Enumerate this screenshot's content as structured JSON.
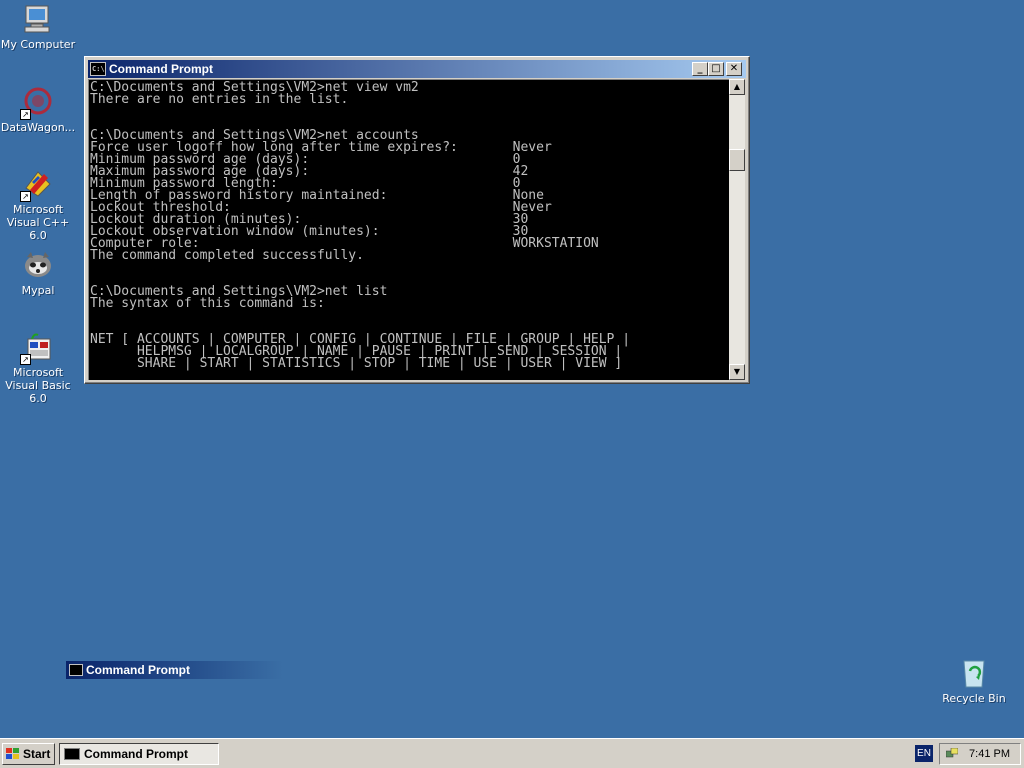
{
  "desktop": {
    "icons": [
      {
        "label": "My Computer",
        "icon": "my-computer-icon"
      },
      {
        "label": "DataWagon...",
        "icon": "datawagon-icon"
      },
      {
        "label": "Microsoft Visual C++ 6.0",
        "icon": "visual-cpp-icon"
      },
      {
        "label": "Mypal",
        "icon": "mypal-browser-icon"
      },
      {
        "label": "Microsoft Visual Basic 6.0",
        "icon": "visual-basic-icon"
      },
      {
        "label": "Recycle Bin",
        "icon": "recycle-bin-icon"
      }
    ],
    "background_color": "#3A6EA5"
  },
  "window": {
    "title": "Command Prompt",
    "title_icon_text": "C:\\",
    "buttons": {
      "minimize": "_",
      "maximize": "□",
      "close": "✕"
    },
    "console_text": "C:\\Documents and Settings\\VM2>net view vm2\nThere are no entries in the list.\n\n\nC:\\Documents and Settings\\VM2>net accounts\nForce user logoff how long after time expires?:       Never\nMinimum password age (days):                          0\nMaximum password age (days):                          42\nMinimum password length:                              0\nLength of password history maintained:                None\nLockout threshold:                                    Never\nLockout duration (minutes):                           30\nLockout observation window (minutes):                 30\nComputer role:                                        WORKSTATION\nThe command completed successfully.\n\n\nC:\\Documents and Settings\\VM2>net list\nThe syntax of this command is:\n\n\nNET [ ACCOUNTS | COMPUTER | CONFIG | CONTINUE | FILE | GROUP | HELP |\n      HELPMSG | LOCALGROUP | NAME | PAUSE | PRINT | SEND | SESSION |\n      SHARE | START | STATISTICS | STOP | TIME | USE | USER | VIEW ]",
    "scrollbar": {
      "up": "▲",
      "down": "▼"
    }
  },
  "minimized_window": {
    "title": "Command Prompt"
  },
  "taskbar": {
    "start_label": "Start",
    "tasks": [
      {
        "label": "Command Prompt"
      }
    ],
    "language": "EN",
    "clock": "7:41 PM"
  },
  "colors": {
    "titlebar_active": "#0A246A",
    "titlebar_gradient_end": "#A6CAF0",
    "console_bg": "#000000",
    "console_fg": "#C0C0C0",
    "taskbar": "#D4D0C8"
  }
}
